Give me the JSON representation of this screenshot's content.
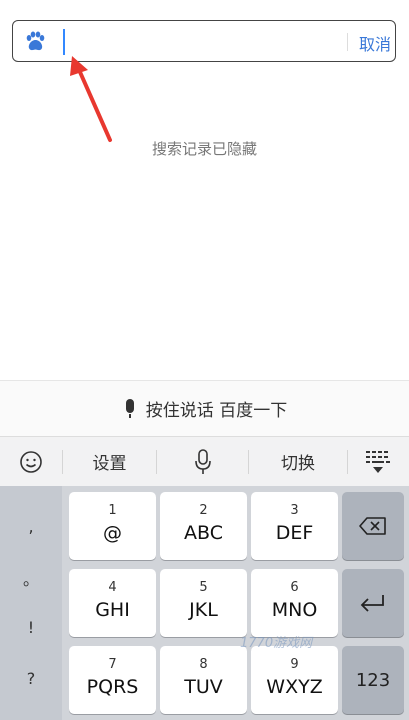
{
  "search": {
    "value": "",
    "cancel_label": "取消"
  },
  "history_message": "搜索记录已隐藏",
  "voice": {
    "label": "按住说话 百度一下"
  },
  "toolbar": {
    "settings_label": "设置",
    "switch_label": "切换"
  },
  "keyboard": {
    "punctuation": [
      ",",
      "。",
      "!",
      "?"
    ],
    "keys": [
      {
        "num": "1",
        "letters": "@"
      },
      {
        "num": "2",
        "letters": "ABC"
      },
      {
        "num": "3",
        "letters": "DEF"
      },
      {
        "num": "4",
        "letters": "GHI"
      },
      {
        "num": "5",
        "letters": "JKL"
      },
      {
        "num": "6",
        "letters": "MNO"
      },
      {
        "num": "7",
        "letters": "PQRS"
      },
      {
        "num": "8",
        "letters": "TUV"
      },
      {
        "num": "9",
        "letters": "WXYZ"
      }
    ],
    "numeric_switch_label": "123"
  },
  "watermark": "1770游戏网",
  "colors": {
    "accent": "#3a78d8",
    "annotation_arrow": "#e8382f"
  }
}
